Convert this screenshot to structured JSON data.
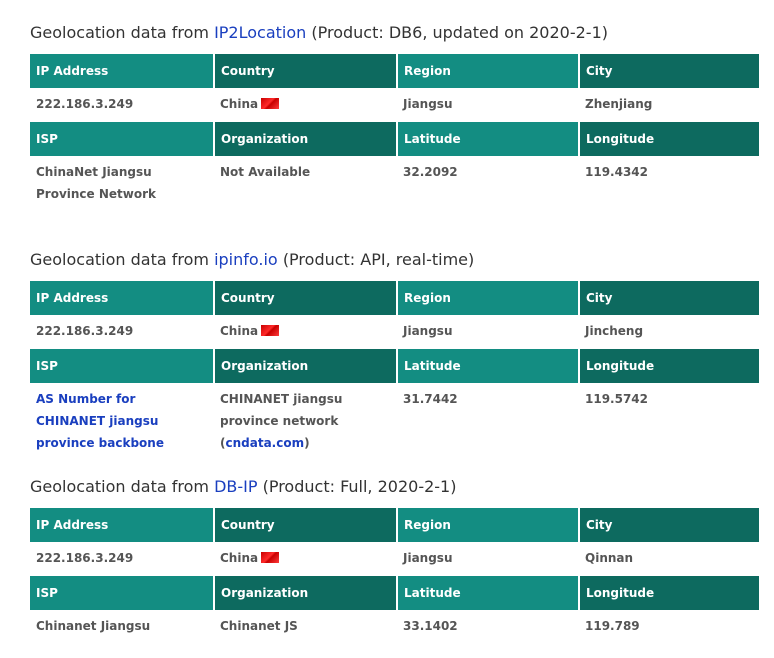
{
  "title_prefix": "Geolocation data from",
  "headers": {
    "ip": "IP Address",
    "country": "Country",
    "region": "Region",
    "city": "City",
    "isp": "ISP",
    "org": "Organization",
    "lat": "Latitude",
    "lon": "Longitude"
  },
  "sections": [
    {
      "source": "IP2Location",
      "product": "(Product: DB6, updated on 2020-2-1)",
      "ip": "222.186.3.249",
      "country": "China",
      "region": "Jiangsu",
      "city": "Zhenjiang",
      "isp": "ChinaNet Jiangsu Province Network",
      "org": "Not Available",
      "lat": "32.2092",
      "lon": "119.4342"
    },
    {
      "source": "ipinfo.io",
      "product": "(Product: API, real-time)",
      "ip": "222.186.3.249",
      "country": "China",
      "region": "Jiangsu",
      "city": "Jincheng",
      "isp": "AS Number for CHINANET jiangsu province backbone",
      "org_prefix": "CHINANET jiangsu province network (",
      "org_link": "cndata.com",
      "org_suffix": ")",
      "lat": "31.7442",
      "lon": "119.5742"
    },
    {
      "source": "DB-IP",
      "product": "(Product: Full, 2020-2-1)",
      "ip": "222.186.3.249",
      "country": "China",
      "region": "Jiangsu",
      "city": "Qinnan",
      "isp": "Chinanet Jiangsu",
      "org": "Chinanet JS",
      "lat": "33.1402",
      "lon": "119.789"
    }
  ],
  "colors": {
    "header_light": "#138d82",
    "header_dark": "#0d6a5f",
    "link": "#1a3fbf"
  },
  "icons": {
    "flag": "china-flag-icon"
  }
}
